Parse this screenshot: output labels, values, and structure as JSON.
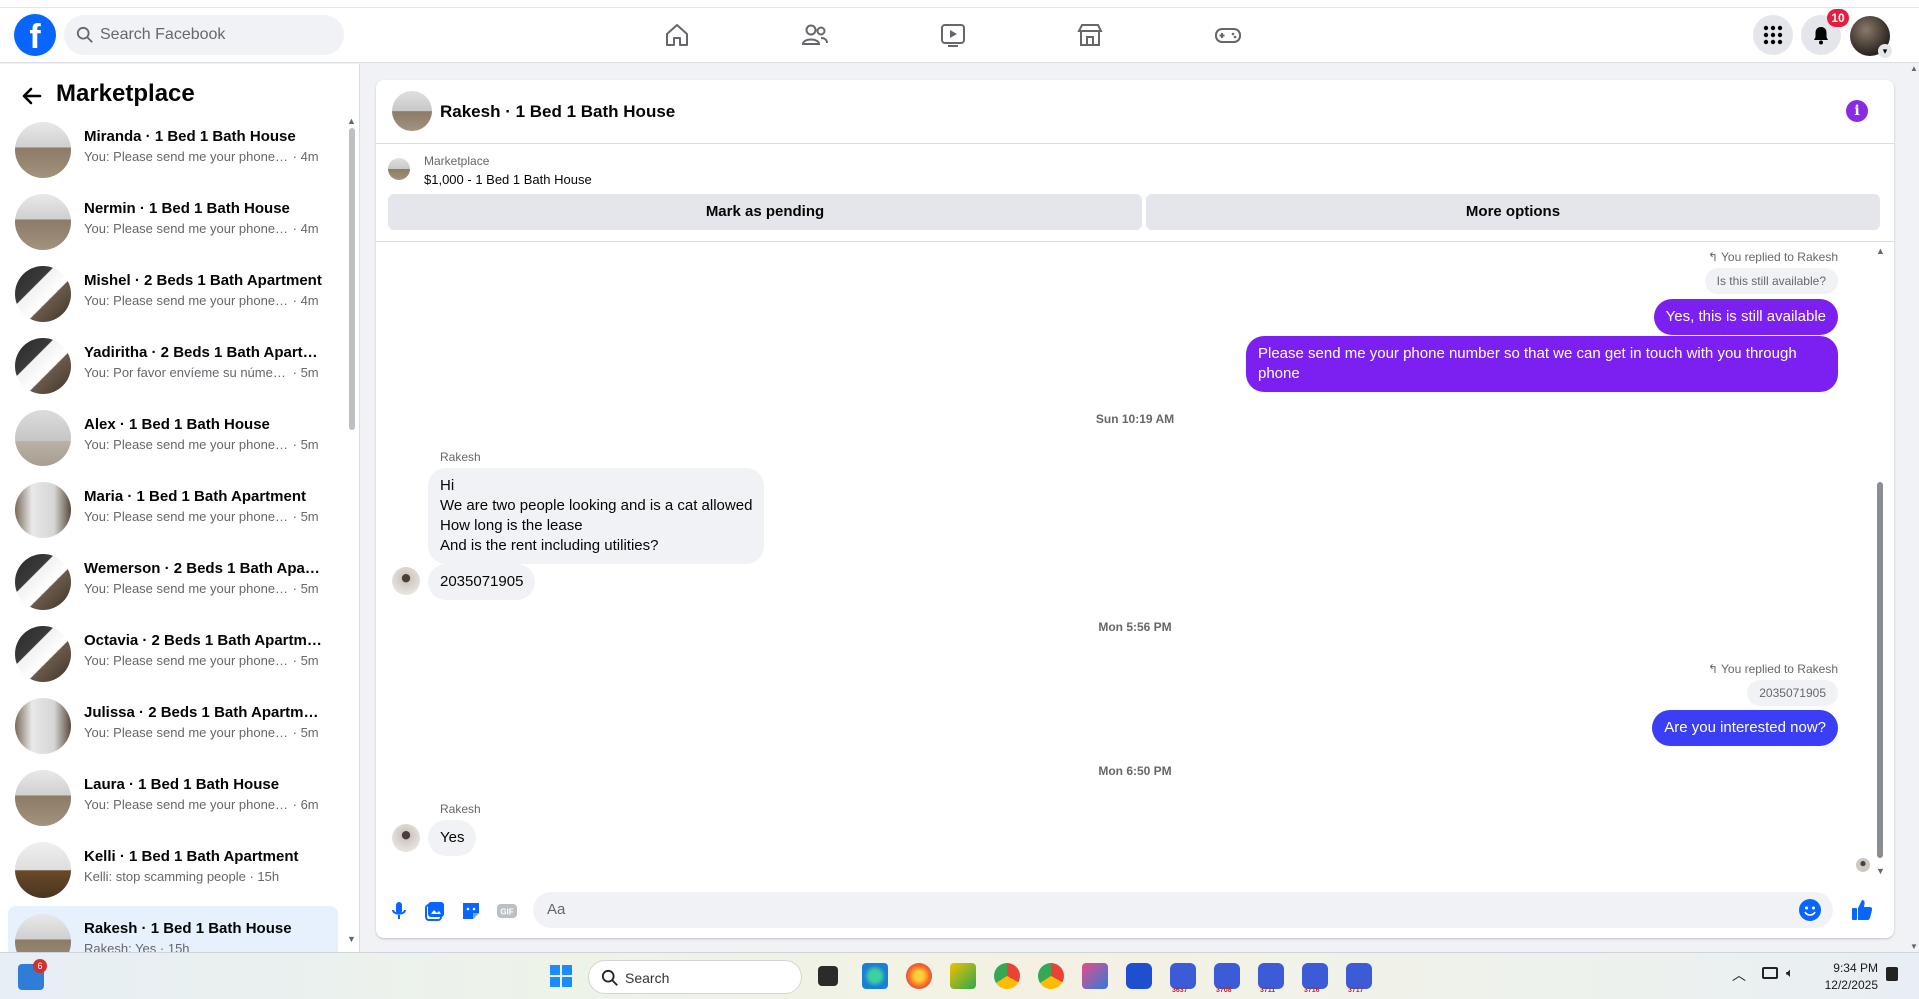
{
  "topbar": {
    "logo": "f",
    "search_placeholder": "Search Facebook",
    "notifications_count": "10",
    "icons": [
      "home-icon",
      "friends-icon",
      "video-icon",
      "marketplace-icon",
      "gaming-icon",
      "menu-grid-icon",
      "bell-icon"
    ]
  },
  "sidebar": {
    "title": "Marketplace",
    "conversations": [
      {
        "name": "Miranda · 1 Bed 1 Bath House",
        "snippet": "You: Please send me your phone n...",
        "time": "4m"
      },
      {
        "name": "Nermin · 1 Bed 1 Bath House",
        "snippet": "You: Please send me your phone n...",
        "time": "4m"
      },
      {
        "name": "Mishel · 2 Beds 1 Bath Apartment",
        "snippet": "You: Please send me your phone n...",
        "time": "4m"
      },
      {
        "name": "Yadiritha · 2 Beds 1 Bath Apartm...",
        "snippet": "You: Por favor envíeme su número ...",
        "time": "5m"
      },
      {
        "name": "Alex · 1 Bed 1 Bath House",
        "snippet": "You: Please send me your phone n...",
        "time": "5m"
      },
      {
        "name": "Maria · 1 Bed 1 Bath Apartment",
        "snippet": "You: Please send me your phone n...",
        "time": "5m"
      },
      {
        "name": "Wemerson · 2 Beds 1 Bath Apart...",
        "snippet": "You: Please send me your phone n...",
        "time": "5m"
      },
      {
        "name": "Octavia · 2 Beds 1 Bath Apartment",
        "snippet": "You: Please send me your phone n...",
        "time": "5m"
      },
      {
        "name": "Julissa · 2 Beds 1 Bath Apartment",
        "snippet": "You: Please send me your phone n...",
        "time": "5m"
      },
      {
        "name": "Laura · 1 Bed 1 Bath House",
        "snippet": "You: Please send me your phone n...",
        "time": "6m"
      },
      {
        "name": "Kelli · 1 Bed 1 Bath Apartment",
        "snippet": "Kelli: stop scamming people",
        "time": "15h"
      },
      {
        "name": "Rakesh · 1 Bed 1 Bath House",
        "snippet": "Rakesh: Yes",
        "time": "15h"
      }
    ]
  },
  "chat": {
    "title": "Rakesh · 1 Bed 1 Bath House",
    "listing_category": "Marketplace",
    "listing_price": "$1,000 - 1 Bed 1 Bath House",
    "mark_pending_label": "Mark as pending",
    "more_options_label": "More options",
    "reply_note": "You replied to Rakesh",
    "quoted_1": "Is this still available?",
    "out_1": "Yes, this is still available",
    "out_2": "Please send me your phone  number so that we can get in touch with you through phone",
    "time_1": "Sun 10:19 AM",
    "sender": "Rakesh",
    "in_1_lines": [
      "Hi",
      "We are two people looking  and is a cat allowed",
      "How long is the lease",
      "And is the rent including utilities?"
    ],
    "in_2": "2035071905",
    "time_2": "Mon 5:56 PM",
    "reply_note_2": "You replied to Rakesh",
    "quoted_2": "2035071905",
    "out_3": "Are you interested now?",
    "time_3": "Mon 6:50 PM",
    "sender_2": "Rakesh",
    "in_3": "Yes",
    "composer_placeholder": "Aa"
  },
  "taskbar": {
    "search_label": "Search",
    "widgets_badge": "6",
    "time": "9:34 PM",
    "date": "12/2/2025",
    "app_labels": [
      "3637",
      "3708",
      "3711",
      "3716",
      "3717"
    ]
  },
  "colors": {
    "brand": "#0866ff",
    "outgoing_purple": "#7b20f0",
    "outgoing_blue": "#3a3ff5",
    "notification_red": "#e41e3f"
  }
}
